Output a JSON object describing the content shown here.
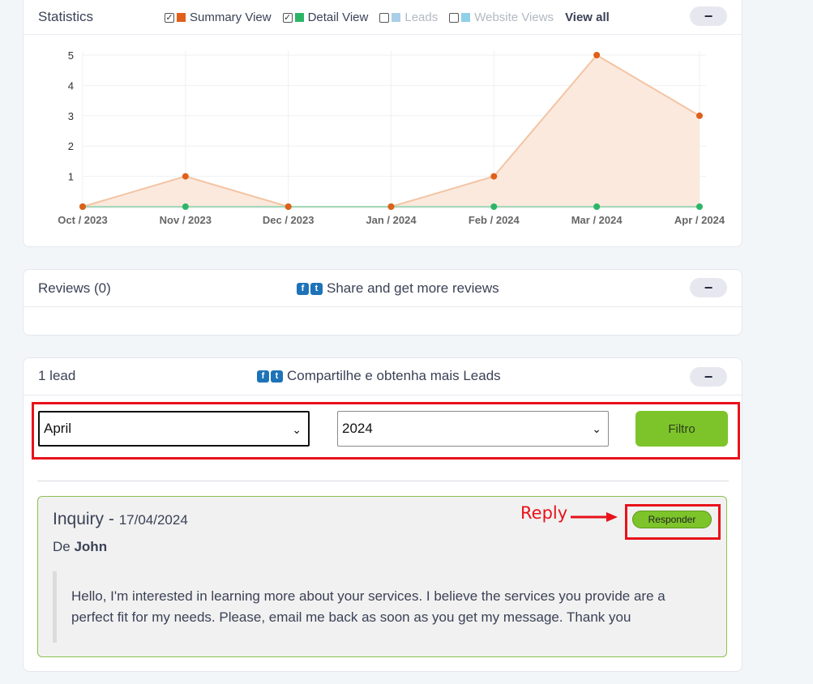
{
  "statistics": {
    "title": "Statistics",
    "legend": [
      {
        "label": "Summary View",
        "checked": true,
        "color": "#e0601a"
      },
      {
        "label": "Detail View",
        "checked": true,
        "color": "#2db566"
      },
      {
        "label": "Leads",
        "checked": false,
        "color": "#a9cfe8"
      },
      {
        "label": "Website Views",
        "checked": false,
        "color": "#8fcfe8"
      }
    ],
    "view_all": "View all",
    "collapse": "−"
  },
  "chart_data": {
    "type": "area",
    "categories": [
      "Oct / 2023",
      "Nov / 2023",
      "Dec / 2023",
      "Jan / 2024",
      "Feb / 2024",
      "Mar / 2024",
      "Apr / 2024"
    ],
    "y_ticks": [
      "1",
      "2",
      "3",
      "4",
      "5"
    ],
    "ylim": [
      0,
      5
    ],
    "grid": true,
    "series": [
      {
        "name": "Summary View",
        "values": [
          0,
          1,
          0,
          0,
          1,
          5,
          3
        ],
        "color": "#e0601a",
        "fill": "#fbe9dd",
        "line": "#f3c4a3"
      },
      {
        "name": "Detail View",
        "values": [
          0,
          0,
          0,
          0,
          0,
          0,
          0
        ],
        "color": "#2db566",
        "line": "#a6d9b8"
      }
    ]
  },
  "reviews": {
    "title": "Reviews (0)",
    "share_text": "Share and get more reviews",
    "collapse": "−"
  },
  "leads": {
    "title": "1 lead",
    "share_text": "Compartilhe e obtenha mais Leads",
    "collapse": "−",
    "month_select": "April",
    "year_select": "2024",
    "filter_button": "Filtro",
    "inquiry": {
      "title": "Inquiry -",
      "date": "17/04/2024",
      "from_prefix": "De",
      "from_name": "John",
      "message": "Hello, I'm interested in learning more about your services. I believe the services you provide are a perfect fit for my needs. Please, email me back as soon as you get my message. Thank you",
      "reply_button": "Responder"
    },
    "annotation": "Reply"
  }
}
